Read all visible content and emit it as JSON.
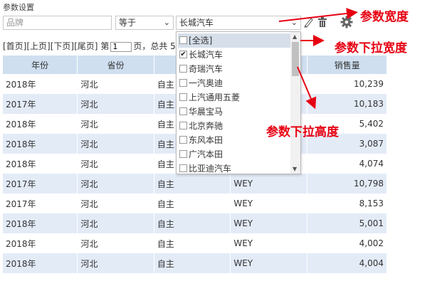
{
  "page": {
    "title": "参数设置"
  },
  "filter": {
    "brand_placeholder": "品牌",
    "operator": "等于",
    "value": "长城汽车"
  },
  "pager": {
    "first": "[首页]",
    "prev": "[上页]",
    "next": "[下页]",
    "last": "[尾页]",
    "page_prefix": "第",
    "page_value": "1",
    "page_suffix": "页，总共 5"
  },
  "table": {
    "headers": [
      "年份",
      "省份",
      "",
      "",
      "销售量"
    ],
    "rows": [
      [
        "2018年",
        "河北",
        "自主",
        "",
        "10,239"
      ],
      [
        "2017年",
        "河北",
        "自主",
        "",
        "10,183"
      ],
      [
        "2018年",
        "河北",
        "自主",
        "",
        "5,402"
      ],
      [
        "2018年",
        "河北",
        "自主",
        "",
        "3,087"
      ],
      [
        "2018年",
        "河北",
        "自主",
        "",
        "4,074"
      ],
      [
        "2017年",
        "河北",
        "自主",
        "WEY",
        "10,798"
      ],
      [
        "2017年",
        "河北",
        "自主",
        "WEY",
        "8,153"
      ],
      [
        "2018年",
        "河北",
        "自主",
        "WEY",
        "5,001"
      ],
      [
        "2018年",
        "河北",
        "自主",
        "WEY",
        "4,002"
      ],
      [
        "2018年",
        "河北",
        "自主",
        "WEY",
        "4,004"
      ]
    ]
  },
  "dropdown": {
    "items": [
      {
        "label": "[全选]",
        "checked": false
      },
      {
        "label": "长城汽车",
        "checked": true
      },
      {
        "label": "奇瑞汽车",
        "checked": false
      },
      {
        "label": "一汽奥迪",
        "checked": false
      },
      {
        "label": "上汽通用五菱",
        "checked": false
      },
      {
        "label": "华晨宝马",
        "checked": false
      },
      {
        "label": "北京奔驰",
        "checked": false
      },
      {
        "label": "东风本田",
        "checked": false
      },
      {
        "label": "广汽本田",
        "checked": false
      },
      {
        "label": "比亚迪汽车",
        "checked": false
      }
    ]
  },
  "annotations": {
    "param_width": "参数宽度",
    "dropdown_width": "参数下拉宽度",
    "dropdown_height": "参数下拉高度"
  },
  "colors": {
    "header_bg": "#cfdff0",
    "alt_row_bg": "#e3ebf7",
    "annotation": "#e60012"
  },
  "icons": [
    "chevron-down-icon",
    "edit-icon",
    "trash-icon",
    "gear-icon",
    "checkmark-icon"
  ]
}
